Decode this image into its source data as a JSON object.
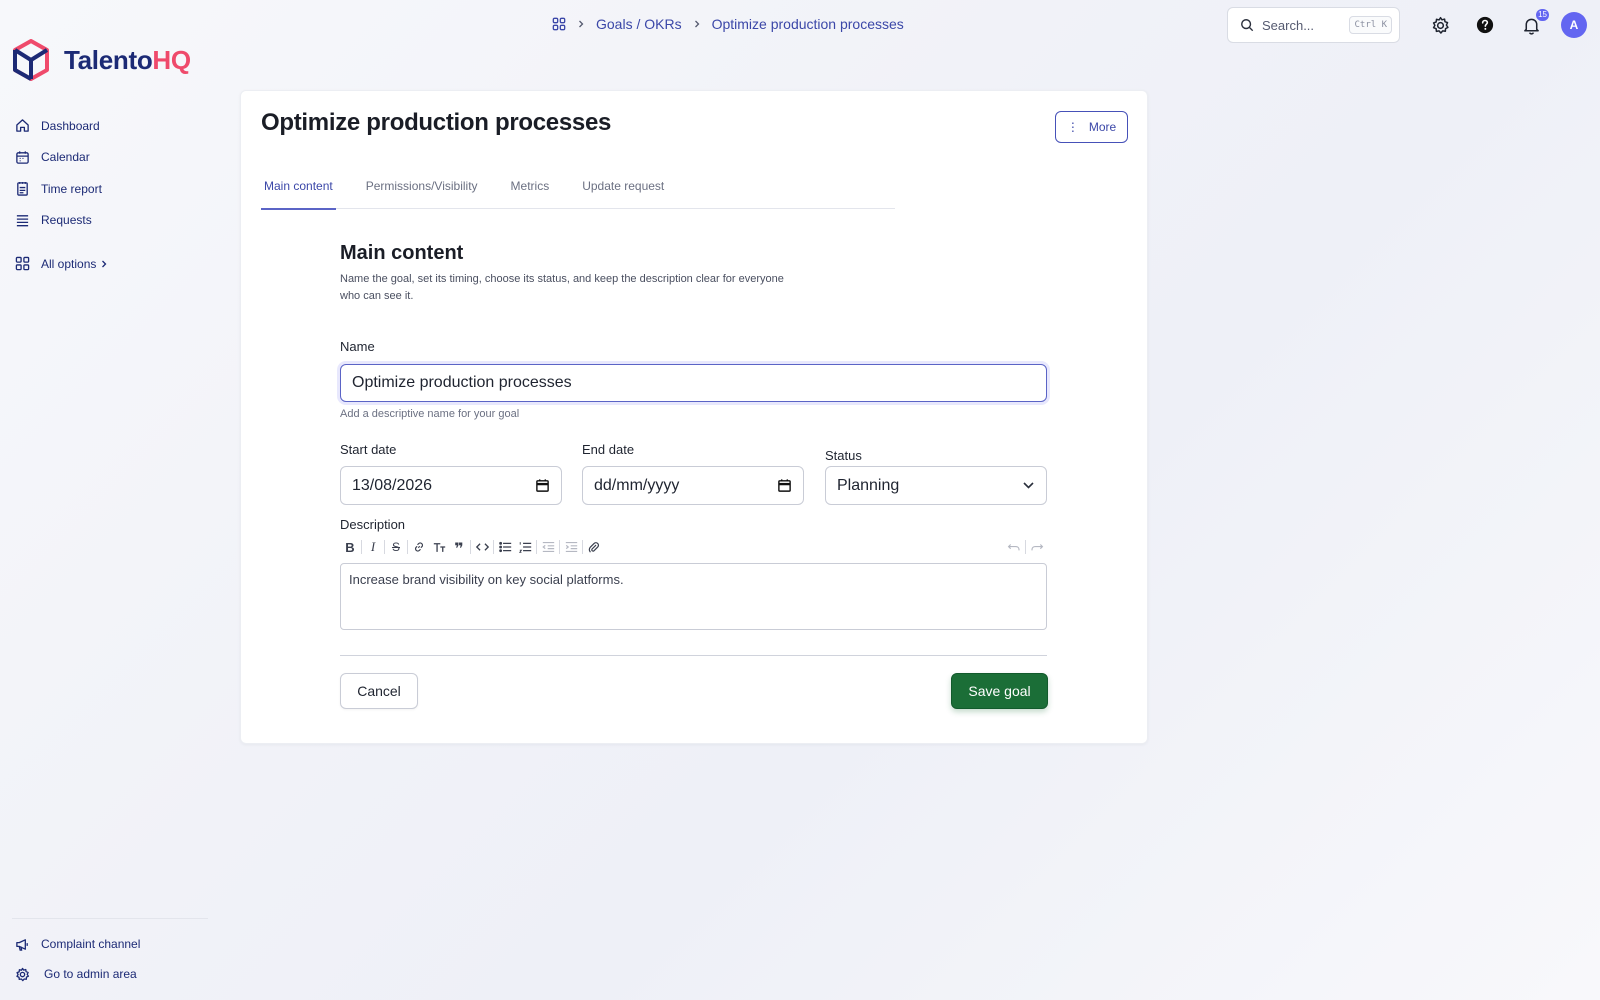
{
  "brand": {
    "name_part1": "Talento",
    "name_part2": "HQ",
    "accent_blue": "#1c2a75",
    "accent_pink": "#ef4a6b",
    "logo_icon": "cube-logo-icon"
  },
  "sidebar": {
    "items": [
      {
        "label": "Dashboard",
        "icon": "home-icon"
      },
      {
        "label": "Calendar",
        "icon": "calendar-icon"
      },
      {
        "label": "Time report",
        "icon": "report-icon"
      },
      {
        "label": "Requests",
        "icon": "list-icon"
      }
    ],
    "all_options": {
      "label": "All options",
      "icon": "grid-icon"
    },
    "bottom_items": [
      {
        "label": "Complaint channel",
        "icon": "megaphone-icon"
      },
      {
        "label": "Go to admin area",
        "icon": "gear-icon"
      }
    ]
  },
  "breadcrumb": {
    "items": [
      "Goals / OKRs",
      "Optimize production processes"
    ],
    "home_icon": "apps-icon"
  },
  "search": {
    "placeholder": "Search...",
    "shortcut": "Ctrl K"
  },
  "topbar": {
    "notifications_count": "15",
    "avatar_initial": "A",
    "icons": [
      "settings-icon",
      "help-icon",
      "bell-icon"
    ]
  },
  "page": {
    "title": "Optimize production processes",
    "more_label": "More",
    "tabs": [
      {
        "label": "Main content",
        "active": true
      },
      {
        "label": "Permissions/Visibility",
        "active": false
      },
      {
        "label": "Metrics",
        "active": false
      },
      {
        "label": "Update request",
        "active": false
      }
    ]
  },
  "form": {
    "section_title": "Main content",
    "section_desc": "Name the goal, set its timing, choose its status, and keep the description clear for everyone who can see it.",
    "name_label": "Name",
    "name_value": "Optimize production processes",
    "name_hint": "Add a descriptive name for your goal",
    "start_label": "Start date",
    "start_value": "13/08/2026",
    "end_label": "End date",
    "end_value": "dd/mm/yyyy",
    "status_label": "Status",
    "status_value": "Planning",
    "description_label": "Description",
    "description_value": "Increase brand visibility on key social platforms.",
    "cancel_label": "Cancel",
    "save_label": "Save goal",
    "save_color": "#1b6e37"
  }
}
